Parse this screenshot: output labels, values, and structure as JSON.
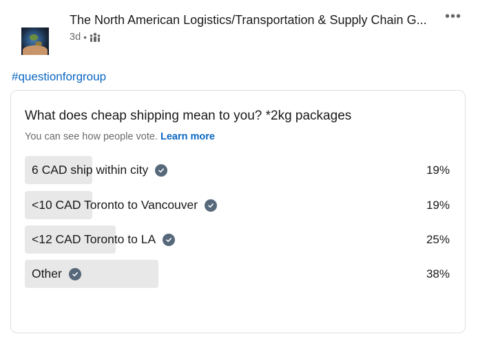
{
  "post": {
    "group_name": "The North American Logistics/Transportation & Supply Chain G...",
    "time_ago": "3d",
    "separator": "•",
    "visibility_icon": "group-icon",
    "more_icon": "ellipsis-icon",
    "more_label": "•••",
    "hashtag": "#questionforgroup"
  },
  "poll": {
    "question": "What does cheap shipping mean to you? *2kg packages",
    "subtext": "You can see how people vote.",
    "learn_more": "Learn more",
    "accent_color": "#0a66c2",
    "options": [
      {
        "label": "6 CAD ship within city",
        "percent_text": "19%",
        "percent": 19,
        "selected_icon": "check-circle-icon"
      },
      {
        "label": "<10 CAD Toronto to Vancouver",
        "percent_text": "19%",
        "percent": 19,
        "selected_icon": "check-circle-icon"
      },
      {
        "label": "<12 CAD Toronto to LA",
        "percent_text": "25%",
        "percent": 25,
        "selected_icon": "check-circle-icon"
      },
      {
        "label": "Other",
        "percent_text": "38%",
        "percent": 38,
        "selected_icon": "check-circle-icon"
      }
    ]
  }
}
